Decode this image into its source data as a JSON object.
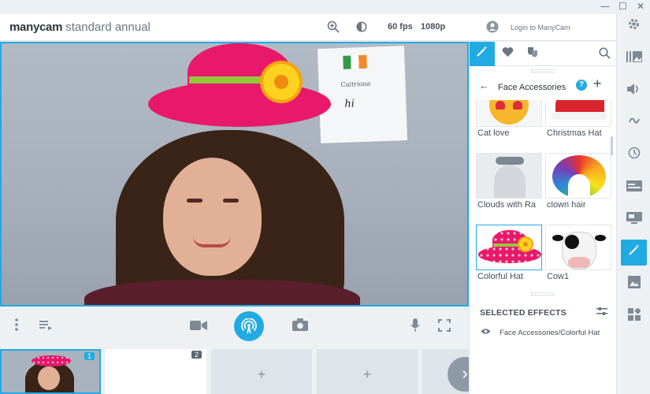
{
  "window": {
    "minimize": "—",
    "maximize": "☐",
    "close": "✕"
  },
  "header": {
    "brand_bold": "manycam",
    "brand_light": "standard annual",
    "fps": "60 fps",
    "resolution": "1080p",
    "login": "Login to ManyCam"
  },
  "preview": {
    "poster_text": "Caitríona",
    "poster_hi": "hi"
  },
  "thumbnails": {
    "items": [
      {
        "num": "1"
      },
      {
        "num": "2"
      },
      {
        "plus": "+"
      },
      {
        "plus": "+"
      }
    ],
    "next": "›"
  },
  "panel": {
    "category": "Face Accessories",
    "help": "?",
    "add": "+",
    "back": "←",
    "effects": [
      {
        "label": "Cat love"
      },
      {
        "label": "Christmas Hat"
      },
      {
        "label": "Clouds with Ra"
      },
      {
        "label": "clown hair"
      },
      {
        "label": "Colorful Hat",
        "selected": true
      },
      {
        "label": "Cow1"
      }
    ],
    "selected_heading": "SELECTED EFFECTS",
    "selected_items": [
      "Face Accessories/Colorful Hat"
    ]
  },
  "colors": {
    "accent": "#22aae3",
    "hat": "#e8196b",
    "band": "#93c83c"
  }
}
